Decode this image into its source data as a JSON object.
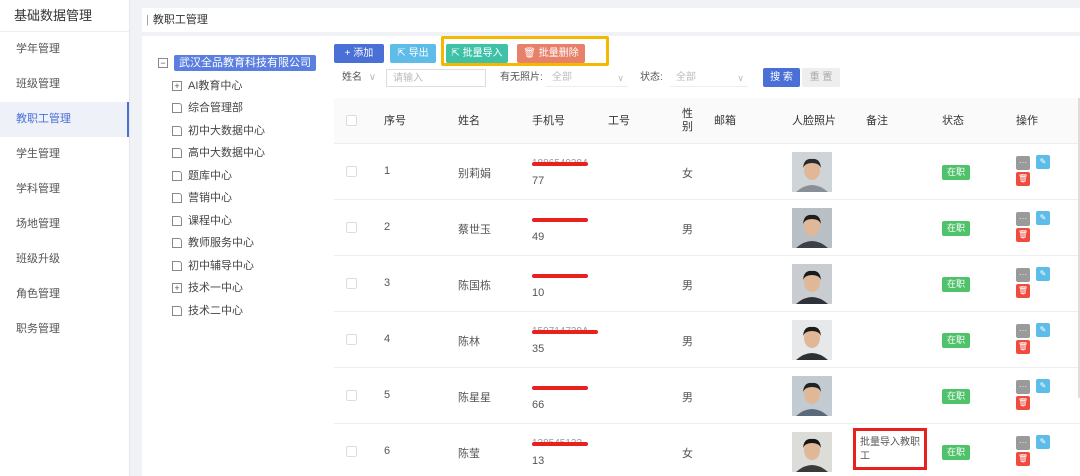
{
  "sidebar": {
    "title": "基础数据管理",
    "items": [
      {
        "label": "学年管理",
        "active": false
      },
      {
        "label": "班级管理",
        "active": false
      },
      {
        "label": "教职工管理",
        "active": true
      },
      {
        "label": "学生管理",
        "active": false
      },
      {
        "label": "学科管理",
        "active": false
      },
      {
        "label": "场地管理",
        "active": false
      },
      {
        "label": "班级升级",
        "active": false
      },
      {
        "label": "角色管理",
        "active": false
      },
      {
        "label": "职务管理",
        "active": false
      }
    ]
  },
  "breadcrumb": {
    "separator": "|",
    "label": "教职工管理"
  },
  "tree": {
    "root": "武汉全品教育科技有限公司",
    "root_toggle": "−",
    "children": [
      {
        "label": "AI教育中心",
        "icon": "plus-box-icon"
      },
      {
        "label": "综合管理部",
        "icon": "file-icon"
      },
      {
        "label": "初中大数据中心",
        "icon": "file-icon"
      },
      {
        "label": "高中大数据中心",
        "icon": "file-icon"
      },
      {
        "label": "题库中心",
        "icon": "file-icon"
      },
      {
        "label": "营销中心",
        "icon": "file-icon"
      },
      {
        "label": "课程中心",
        "icon": "file-icon"
      },
      {
        "label": "教师服务中心",
        "icon": "file-icon"
      },
      {
        "label": "初中辅导中心",
        "icon": "file-icon"
      },
      {
        "label": "技术一中心",
        "icon": "plus-box-icon"
      },
      {
        "label": "技术二中心",
        "icon": "file-icon"
      }
    ]
  },
  "toolbar": {
    "add_label": "+ 添加",
    "export_label": "⇱ 导出",
    "import_label": "⇱ 批量导入",
    "delete_label": "🗑 批量删除",
    "add_color": "#4a6fd6",
    "export_color": "#5dbde8",
    "import_color": "#3fc1a8",
    "delete_color": "#e8816a",
    "highlight_color": "#f5b800"
  },
  "filters": {
    "field_select": "姓名",
    "input_placeholder": "请输入",
    "photo_label": "有无照片:",
    "photo_value": "全部",
    "status_label": "状态:",
    "status_value": "全部",
    "search_label": "搜 索",
    "reset_label": "重 置"
  },
  "table": {
    "headers": {
      "index": "序号",
      "name": "姓名",
      "phone": "手机号",
      "staff_no": "工号",
      "gender_line1": "性",
      "gender_line2": "别",
      "email": "邮箱",
      "photo": "人脸照片",
      "remark": "备注",
      "status": "状态",
      "actions": "操作"
    },
    "rows": [
      {
        "index": "1",
        "name": "别莉娟",
        "phone_mid": "1886549384",
        "phone_tail": "77",
        "gender": "女",
        "remark": "",
        "status": "在职"
      },
      {
        "index": "2",
        "name": "蔡世玉",
        "phone_mid": "",
        "phone_tail": "49",
        "gender": "男",
        "remark": "",
        "status": "在职"
      },
      {
        "index": "3",
        "name": "陈国栋",
        "phone_mid": "",
        "phone_tail": "10",
        "gender": "男",
        "remark": "",
        "status": "在职"
      },
      {
        "index": "4",
        "name": "陈林",
        "phone_mid": "159714739A",
        "phone_tail": "35",
        "gender": "男",
        "remark": "",
        "status": "在职"
      },
      {
        "index": "5",
        "name": "陈星星",
        "phone_mid": "",
        "phone_tail": "66",
        "gender": "男",
        "remark": "",
        "status": "在职"
      },
      {
        "index": "6",
        "name": "陈莹",
        "phone_mid": "138545133",
        "phone_tail": "13",
        "gender": "女",
        "remark": "批量导入教职工",
        "status": "在职"
      }
    ],
    "status_color": "#4fc26b",
    "redact_color": "#e8211e",
    "remark_highlight_color": "#e8211e"
  }
}
